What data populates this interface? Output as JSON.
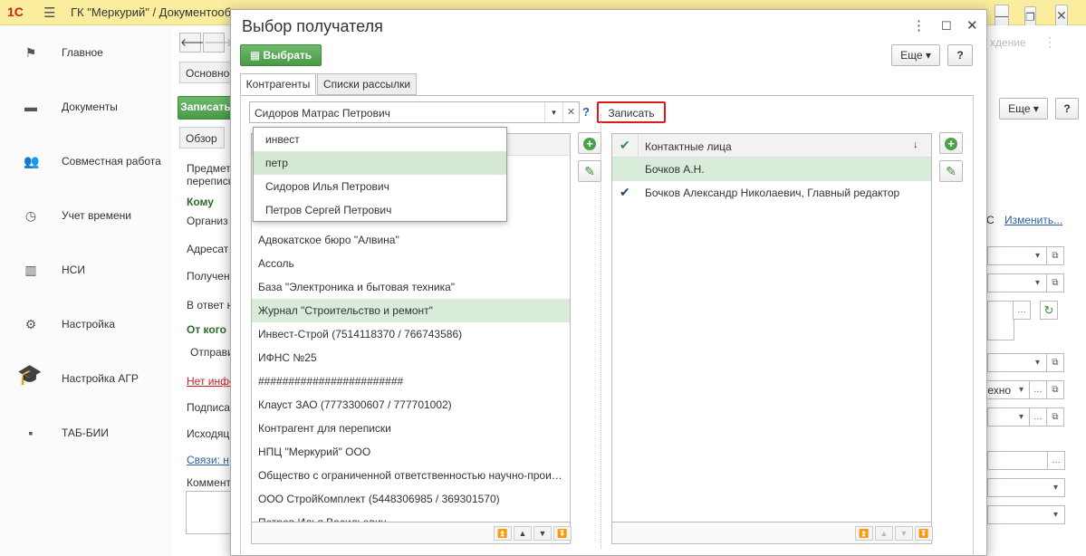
{
  "topbar": {
    "logo": "1С",
    "title": "ГК \"Меркурий\" / Документооборот"
  },
  "sidebar": {
    "items": [
      {
        "label": "Главное",
        "icon": "flag-icon"
      },
      {
        "label": "Документы",
        "icon": "folder-icon"
      },
      {
        "label": "Совместная работа",
        "icon": "people-icon"
      },
      {
        "label": "Учет времени",
        "icon": "clock-icon"
      },
      {
        "label": "НСИ",
        "icon": "books-icon"
      },
      {
        "label": "Настройка",
        "icon": "gear-icon"
      },
      {
        "label": "Настройка АГР",
        "icon": "graduation-cap-icon"
      },
      {
        "label": "ТАБ-БИИ",
        "icon": "tab-icon"
      }
    ]
  },
  "bgform": {
    "tab_main": "Основное",
    "save_button": "Записать",
    "tab_overview": "Обзор",
    "subject_label": "Предмет",
    "subject_label2": "переписк",
    "to_heading": "Кому",
    "org_label": "Организ",
    "address_label": "Адресат",
    "received_label": "Получен",
    "reply_label": "В ответ н",
    "from_heading": "От кого",
    "sender_label": "Отправи",
    "no_info_link": "Нет инфо",
    "signed_label": "Подписал",
    "outgoing_label": "Исходяц",
    "links_label": "Связи: н",
    "comment_label": "Коммента",
    "right_c": "С",
    "change_link": "Изменить...",
    "faded_tab": "хдение",
    "right_text": "техно",
    "more_button": "Еще",
    "help_button": "?"
  },
  "modal": {
    "title": "Выбор получателя",
    "select_button": "Выбрать",
    "more_button": "Еще",
    "help_button": "?",
    "tabs": [
      "Контрагенты",
      "Списки рассылки"
    ],
    "search_value": "Сидоров Матрас Петрович",
    "search_help": "?",
    "save_button": "Записать",
    "dropdown_items": [
      "инвест",
      "петр",
      "Сидоров Илья Петрович",
      "Петров Сергей Петрович"
    ],
    "dropdown_highlight_index": 1,
    "contractors": [
      "Адвокатское бюро \"Алвина\"",
      "Ассоль",
      "База \"Электроника и бытовая техника\"",
      "Журнал \"Строительство и ремонт\"",
      "Инвест-Строй (7514118370 / 766743586)",
      "ИФНС №25",
      "########################",
      "Клауст ЗАО (7773300607 / 777701002)",
      "Контрагент для переписки",
      "НПЦ \"Меркурий\" ООО",
      "Общество с ограниченной ответственностью научно-производственное",
      "ООО СтройКомплект (5448306985 / 369301570)",
      "Петров Илья Васильевич"
    ],
    "contractors_selected_index": 3,
    "contacts_header": "Контактные лица",
    "contacts": [
      {
        "name": "Бочков А.Н.",
        "checked": false
      },
      {
        "name": "Бочков Александр Николаевич, Главный редактор",
        "checked": true
      }
    ]
  }
}
